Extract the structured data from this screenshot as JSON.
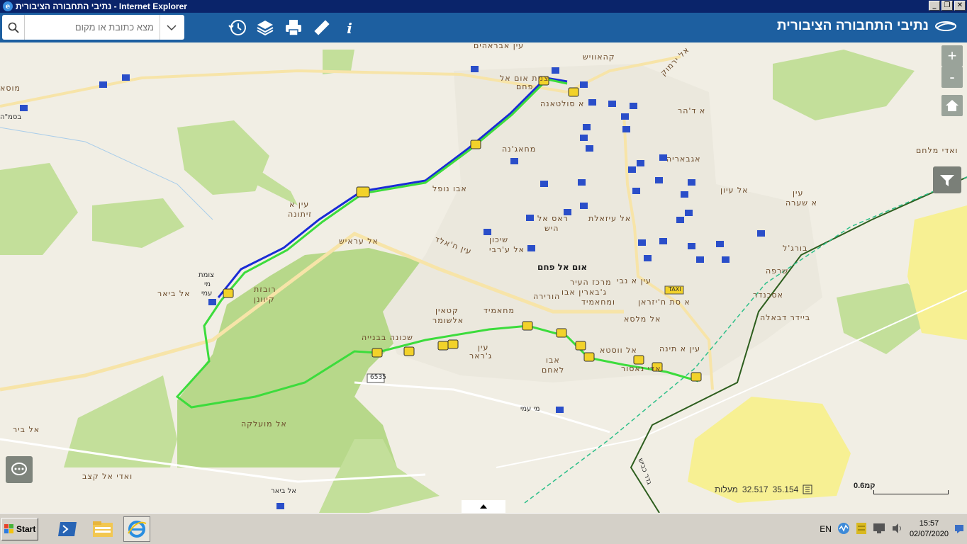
{
  "window": {
    "title": "נתיבי התחבורה הציבורית - Internet Explorer"
  },
  "header": {
    "brand": "נתיבי התחבורה הציבורית",
    "search_placeholder": "מצא כתובת או מקום"
  },
  "map": {
    "labels": {
      "ein_ibrahim": "עין אבראהים",
      "kahawish": "קהאוויש",
      "jct_umm": "צמת אום אל",
      "faham": "פחם",
      "sultana": "א סולטאנה",
      "yarmouk": "אל ירמוק",
      "dahr": "א ד'הר",
      "mahajna": "מחאג'נה",
      "agbaria": "אגבאריה",
      "wadi_milham": "ואדי מלחם",
      "ein_zeitouna_1": "עין א",
      "ein_zeitouna_2": "זיתונה",
      "abu_nufal": "אבו נופל",
      "al_uyun": "אל עיון",
      "ein_shara_1": "עין",
      "ein_shara_2": "א שערה",
      "raas_hish": "ראס אל",
      "hish": "היש",
      "al_araish": "אל עראיש",
      "zalfa": "אל עיזאלת",
      "shikun": "שיכון",
      "ein_jarbi": "אל ע'רבי",
      "ein_khalid": "עין ח'אלד",
      "umm_al_fahm": "אום אל פחם",
      "bourj": "בורג'ל",
      "sharafa": "שרפה",
      "jct_mei_ami_1": "צומת",
      "jct_mei_ami_2": "מי",
      "jct_mei_ami_3": "עמי",
      "al_bir": "אל ביאר",
      "ruvat": "רובזת",
      "kiyunan": "קיוונן",
      "ein_nabi": "עין א נבי",
      "city_center": "מרכז העיר",
      "hariri": "ג'בארין אבו",
      "hurira": "הורירה",
      "mahamid": "ומחאמיד",
      "iskandar": "אסכנדר",
      "sat_khizran": "א סת ח'יזראן",
      "ketain": "קטאין",
      "alshumar": "אלשומר",
      "mahamid2": "מחאמיד",
      "malsa": "אל מלסא",
      "biedar": "ביידר דבאלה",
      "shchuna": "שכונה בבנייה",
      "jar": "ג'ראר",
      "ein_jar": "עין",
      "abu_laham": "אבו",
      "laham": "לאחם",
      "wusta": "אל ווסטא",
      "ein_tina": "עין א תינה",
      "nasir": "ואדי נאסור",
      "bir": "אל ביר",
      "moalka": "אל מועלקה",
      "wadi_kazab": "ואדי אל קצב",
      "mei_ami": "מי עמי",
      "al_bisa": "אל ביאר",
      "bsma": "בסמ\"ה",
      "mousa": "מוסא",
      "kvish": "גדר כביש",
      "road": "6535",
      "taxi": "TAXI"
    },
    "coords": {
      "lat": "32.517",
      "lon": "35.154",
      "unit": "מעלות"
    },
    "scale": "0.6קמ"
  },
  "taskbar": {
    "start": "Start",
    "lang": "EN",
    "time": "15:57",
    "date": "02/07/2020"
  }
}
